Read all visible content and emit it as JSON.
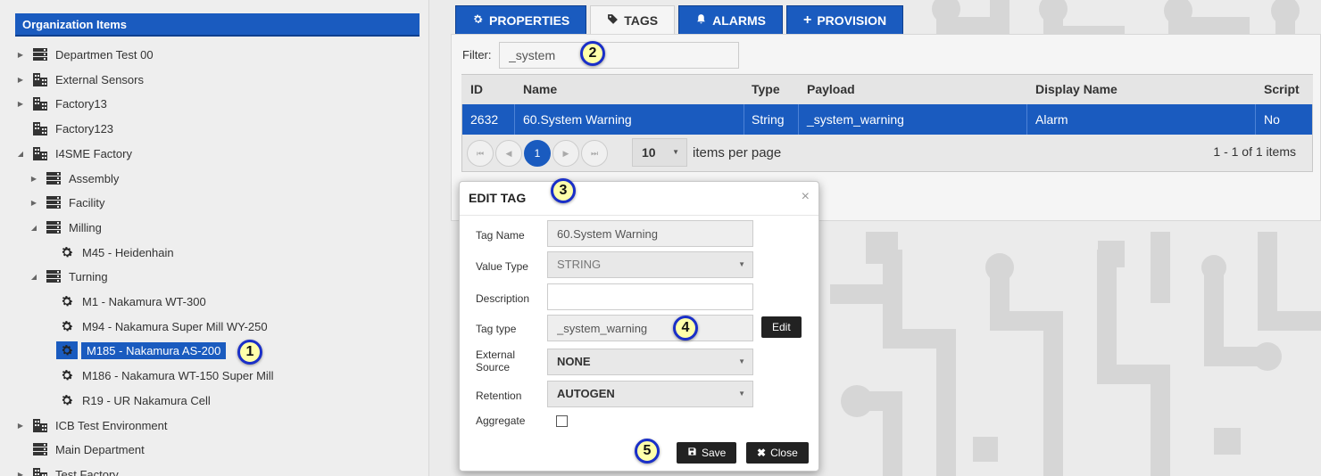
{
  "sidebar": {
    "title": "Organization Items",
    "items": [
      {
        "label": "Departmen Test 00",
        "icon": "server-icon",
        "arrow": "collapsed",
        "indent": 0
      },
      {
        "label": "External Sensors",
        "icon": "building-icon",
        "arrow": "collapsed",
        "indent": 0
      },
      {
        "label": "Factory13",
        "icon": "building-icon",
        "arrow": "collapsed",
        "indent": 0
      },
      {
        "label": "Factory123",
        "icon": "building-icon",
        "arrow": "none",
        "indent": 0
      },
      {
        "label": "I4SME Factory",
        "icon": "building-icon",
        "arrow": "expanded",
        "indent": 0
      },
      {
        "label": "Assembly",
        "icon": "server-icon",
        "arrow": "collapsed",
        "indent": 1
      },
      {
        "label": "Facility",
        "icon": "server-icon",
        "arrow": "collapsed",
        "indent": 1
      },
      {
        "label": "Milling",
        "icon": "server-icon",
        "arrow": "expanded",
        "indent": 1
      },
      {
        "label": "M45 - Heidenhain",
        "icon": "gear-icon",
        "arrow": "none",
        "indent": 2
      },
      {
        "label": "Turning",
        "icon": "server-icon",
        "arrow": "expanded",
        "indent": 1
      },
      {
        "label": "M1 - Nakamura WT-300",
        "icon": "gear-icon",
        "arrow": "none",
        "indent": 2
      },
      {
        "label": "M94 - Nakamura Super Mill WY-250",
        "icon": "gear-icon",
        "arrow": "none",
        "indent": 2
      },
      {
        "label": "M185 - Nakamura AS-200",
        "icon": "gear-icon",
        "arrow": "none",
        "indent": 2,
        "selected": true
      },
      {
        "label": "M186 - Nakamura WT-150 Super Mill",
        "icon": "gear-icon",
        "arrow": "none",
        "indent": 2
      },
      {
        "label": "R19 - UR Nakamura Cell",
        "icon": "gear-icon",
        "arrow": "none",
        "indent": 2
      },
      {
        "label": "ICB Test Environment",
        "icon": "building-icon",
        "arrow": "collapsed",
        "indent": 0
      },
      {
        "label": "Main Department",
        "icon": "server-icon",
        "arrow": "none",
        "indent": 0
      },
      {
        "label": "Test Factory",
        "icon": "building-icon",
        "arrow": "collapsed",
        "indent": 0
      }
    ]
  },
  "tabs": [
    {
      "label": "PROPERTIES",
      "icon": "gear-icon",
      "active": false
    },
    {
      "label": "TAGS",
      "icon": "tag-icon",
      "active": true
    },
    {
      "label": "ALARMS",
      "icon": "bell-icon",
      "active": false
    },
    {
      "label": "PROVISION",
      "icon": "plus-icon",
      "active": false
    }
  ],
  "filter": {
    "label": "Filter:",
    "value": "_system"
  },
  "grid": {
    "columns": [
      "ID",
      "Name",
      "Type",
      "Payload",
      "Display Name",
      "Script"
    ],
    "rows": [
      [
        "2632",
        "60.System Warning",
        "String",
        "_system_warning",
        "Alarm",
        "No"
      ]
    ]
  },
  "pager": {
    "current_page": "1",
    "page_size": "10",
    "items_per_page_label": "items per page",
    "info": "1 - 1 of 1 items"
  },
  "modal": {
    "title": "EDIT TAG",
    "close_glyph": "×",
    "fields": {
      "tag_name": {
        "label": "Tag Name",
        "value": "60.System Warning"
      },
      "value_type": {
        "label": "Value Type",
        "value": "STRING"
      },
      "description": {
        "label": "Description",
        "value": ""
      },
      "tag_type": {
        "label": "Tag type",
        "value": "_system_warning",
        "button": "Edit"
      },
      "external_source": {
        "label": "External Source",
        "value": "NONE"
      },
      "retention": {
        "label": "Retention",
        "value": "AUTOGEN"
      },
      "aggregate": {
        "label": "Aggregate",
        "checked": false
      }
    },
    "save_label": "Save",
    "close_label": "Close"
  },
  "callouts": [
    "1",
    "2",
    "3",
    "4",
    "5"
  ],
  "colors": {
    "accent": "#1a5bbf",
    "callout_fill": "#ffffaa",
    "callout_border": "#1a2fc8"
  }
}
